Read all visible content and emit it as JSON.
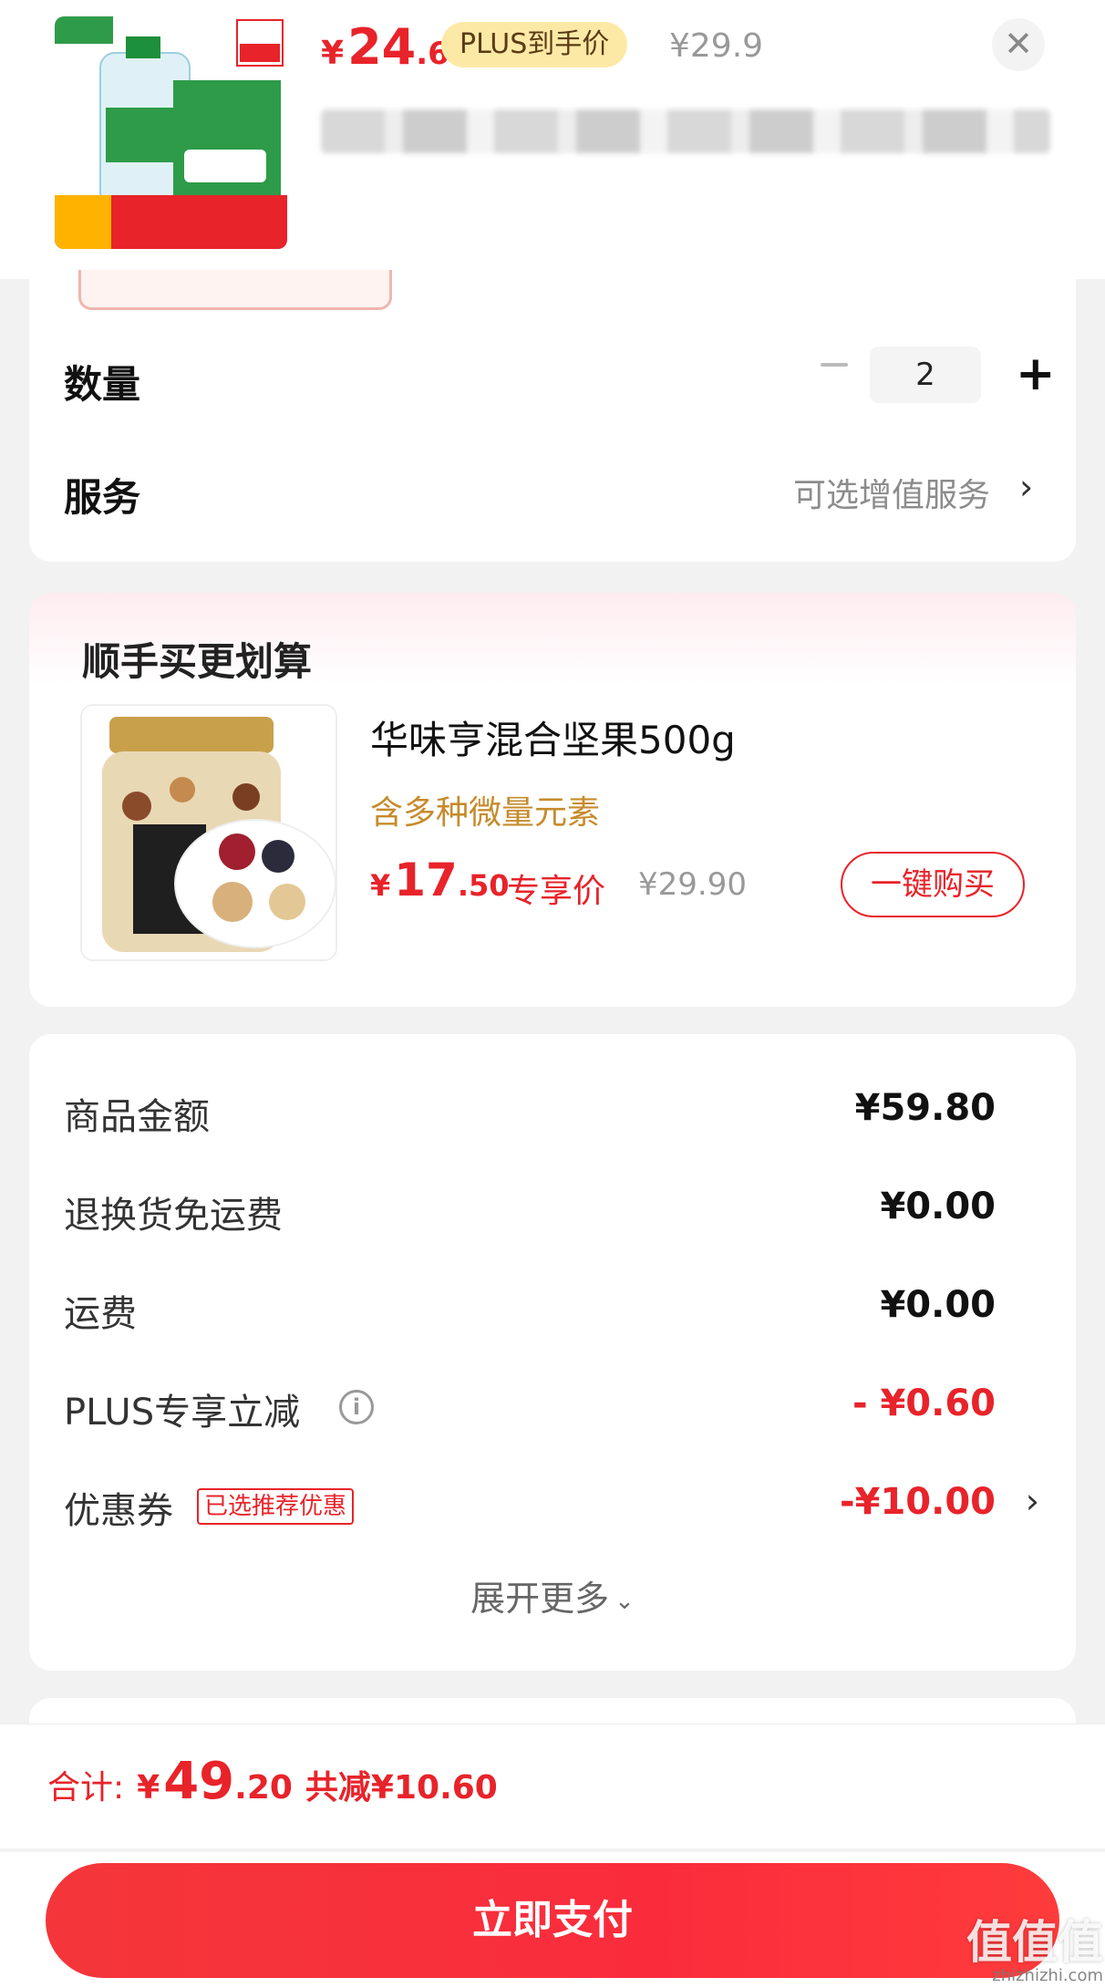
{
  "product": {
    "price_currency": "¥",
    "price_int": "24",
    "price_dec": ".6",
    "plus_tag": "PLUS到手价",
    "original_price": "¥29.9",
    "close_icon": "close-icon"
  },
  "options": {
    "qty_label": "数量",
    "qty_value": "2",
    "qty_minus": "−",
    "qty_plus": "+",
    "service_label": "服务",
    "service_hint": "可选增值服务",
    "service_chevron": "›"
  },
  "recommend": {
    "title": "顺手买更划算",
    "item_name": "华味亨混合坚果500g",
    "item_sub": "含多种微量元素",
    "price_currency": "¥",
    "price_int": "17",
    "price_dec": ".50",
    "price_tag": "专享价",
    "original_price": "¥29.90",
    "buy_label": "一键购买"
  },
  "summary": {
    "rows": [
      {
        "label": "商品金额",
        "value": "¥59.80"
      },
      {
        "label": "退换货免运费",
        "value": "¥0.00"
      },
      {
        "label": "运费",
        "value": "¥0.00"
      },
      {
        "label": "PLUS专享立减",
        "value": "- ¥0.60"
      },
      {
        "label": "优惠券",
        "badge": "已选推荐优惠",
        "value": "-¥10.00"
      }
    ],
    "info_icon": "i",
    "coupon_chevron": "›",
    "expand_label": "展开更多",
    "expand_chevron": "⌄"
  },
  "footer": {
    "total_label": "合计:",
    "total_currency": "¥",
    "total_int": "49",
    "total_dec": ".20",
    "saved": "共减¥10.60",
    "pay_label": "立即支付"
  },
  "watermark": {
    "brand": "值值值",
    "domain": "zhizhizhi.com"
  },
  "colors": {
    "accent_red": "#e8232a",
    "plus_gold": "#fde9a6",
    "promo_text": "#c68b2c"
  }
}
